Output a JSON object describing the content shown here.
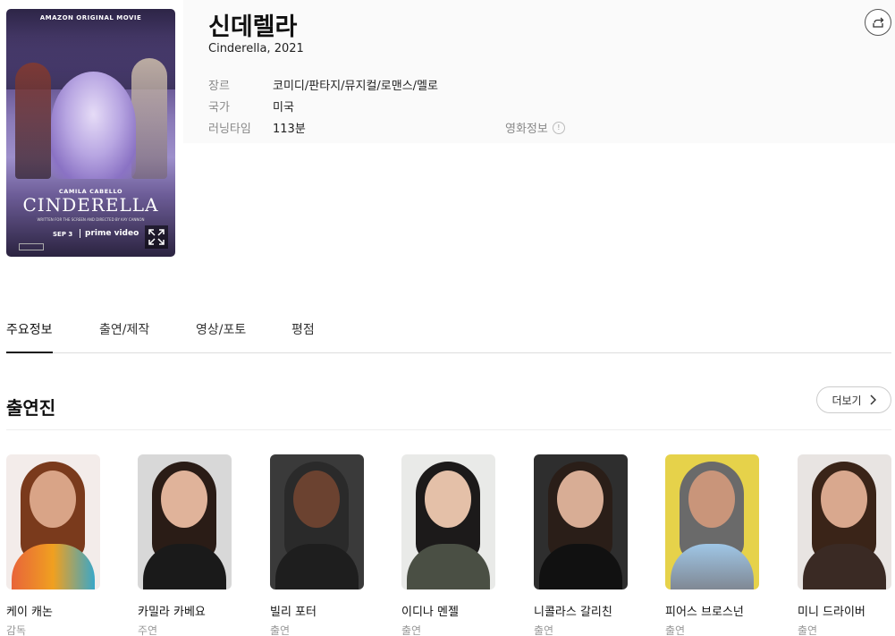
{
  "movie": {
    "title": "신데렐라",
    "subtitle": "Cinderella, 2021",
    "info": [
      {
        "label": "장르",
        "value": "코미디/판타지/뮤지컬/로맨스/멜로"
      },
      {
        "label": "국가",
        "value": "미국"
      },
      {
        "label": "러닝타임",
        "value": "113분"
      }
    ],
    "info_link": "영화정보"
  },
  "poster": {
    "top_text": "AMAZON ORIGINAL MOVIE",
    "star": "CAMILA CABELLO",
    "title": "CINDERELLA",
    "credit": "WRITTEN FOR THE SCREEN AND DIRECTED BY KAY CANNON",
    "release": "SEP 3",
    "platform": "prime video"
  },
  "tabs": [
    "주요정보",
    "출연/제작",
    "영상/포토",
    "평점"
  ],
  "cast_section": {
    "title": "출연진",
    "more_label": "더보기"
  },
  "cast": [
    {
      "name": "케이 캐논",
      "role": "감독"
    },
    {
      "name": "카밀라 카베요",
      "role": "주연"
    },
    {
      "name": "빌리 포터",
      "role": "출연"
    },
    {
      "name": "이디나 멘젤",
      "role": "출연"
    },
    {
      "name": "니콜라스 갈리친",
      "role": "출연"
    },
    {
      "name": "피어스 브로스넌",
      "role": "출연"
    },
    {
      "name": "미니 드라이버",
      "role": "출연"
    }
  ]
}
